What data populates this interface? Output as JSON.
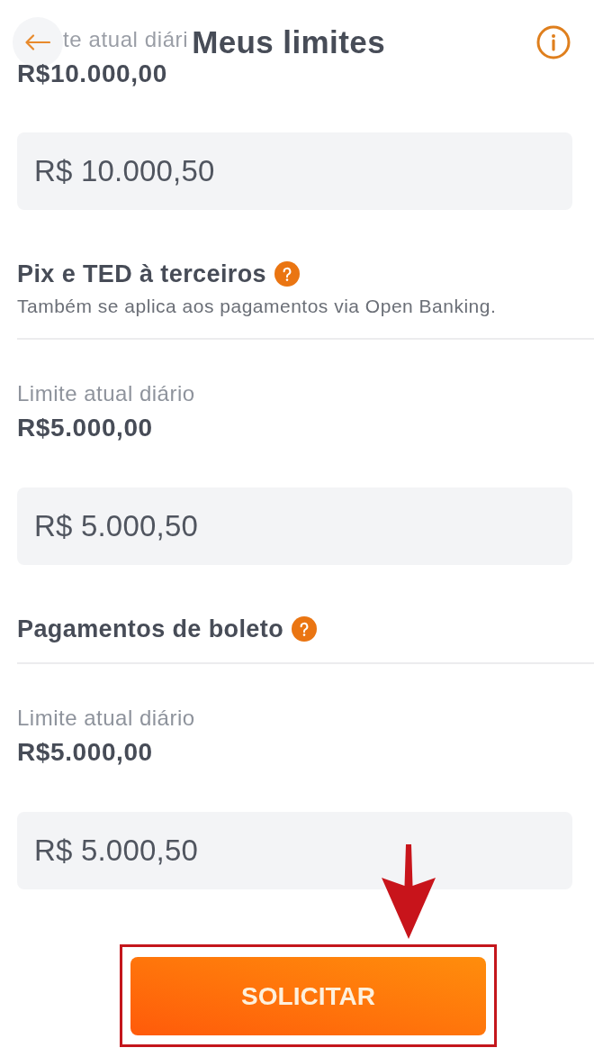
{
  "header": {
    "title": "Meus limites"
  },
  "sections": [
    {
      "limit_label": "te atual diári",
      "limit_value": "R$10.000,00",
      "new_limit": "R$ 10.000,50"
    },
    {
      "title": "Pix e TED à terceiros",
      "description": "Também se aplica aos pagamentos via Open Banking.",
      "limit_label": "Limite atual diário",
      "limit_value": "R$5.000,00",
      "new_limit": "R$ 5.000,50"
    },
    {
      "title": "Pagamentos de boleto",
      "limit_label": "Limite atual diário",
      "limit_value": "R$5.000,00",
      "new_limit": "R$ 5.000,50"
    }
  ],
  "submit_button": {
    "label": "SOLICITAR",
    "highlighted": true
  }
}
